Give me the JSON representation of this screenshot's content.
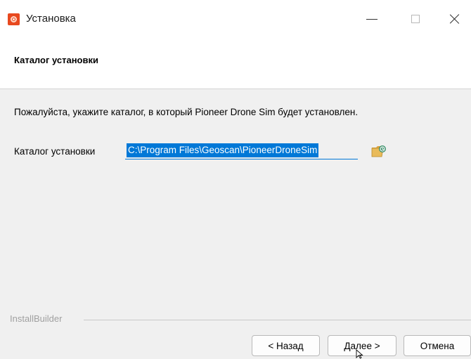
{
  "window": {
    "title": "Установка",
    "icon": "app-icon",
    "controls": {
      "minimize": "minimize-icon",
      "maximize": "maximize-icon",
      "close": "close-icon"
    }
  },
  "header": {
    "title": "Каталог установки"
  },
  "content": {
    "instruction": "Пожалуйста, укажите каталог, в который Pioneer Drone Sim будет установлен.",
    "directory": {
      "label": "Каталог установки",
      "value": "C:\\Program Files\\Geoscan\\PioneerDroneSim",
      "browse_icon": "folder-browse-icon"
    }
  },
  "footer": {
    "brand": "InstallBuilder",
    "buttons": {
      "back": "< Назад",
      "next": "Далее >",
      "cancel": "Отмена"
    }
  },
  "colors": {
    "accent": "#0078d7",
    "app_icon": "#e8491f"
  }
}
